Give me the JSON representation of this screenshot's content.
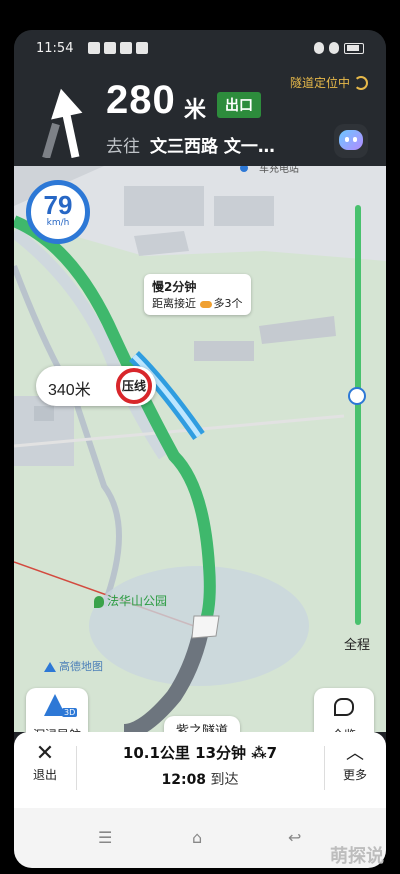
{
  "status": {
    "time": "11:54"
  },
  "nav": {
    "tunnel_label": "隧道定位中",
    "distance": "280",
    "distance_unit": "米",
    "exit_label": "出口",
    "goto_label": "去往",
    "goto_road": "文三西路 文一…"
  },
  "map": {
    "speed_value": "79",
    "speed_unit": "km/h",
    "callout_title": "慢2分钟",
    "callout_sub": "距离接近",
    "callout_extra": "多3个",
    "warning_distance": "340米",
    "warning_sign": "压线",
    "park_label": "法华山公园",
    "map_brand": "高德地图",
    "scale_label": "全程",
    "place_label": "车充电站"
  },
  "buttons": {
    "immersive_label": "沉浸导航",
    "immersive_badge": "3D",
    "tunnel_name": "紫之隧道",
    "overview_label": "全览"
  },
  "bottom": {
    "exit_icon": "✕",
    "exit_label": "退出",
    "distance": "10.1公里",
    "duration": "13分钟",
    "lights": "7",
    "arrival_time": "12:08",
    "arrival_label": "到达",
    "more_label": "更多"
  },
  "watermark": "萌探说"
}
